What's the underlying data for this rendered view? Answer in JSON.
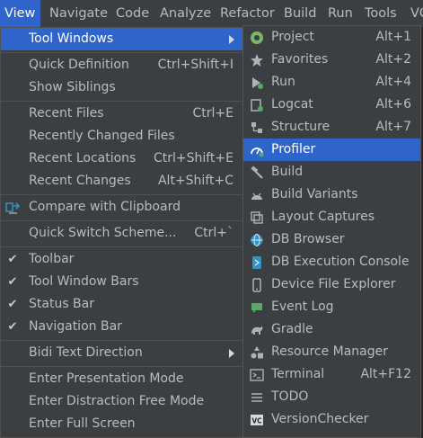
{
  "menubar": {
    "items": [
      "View",
      "Navigate",
      "Code",
      "Analyze",
      "Refactor",
      "Build",
      "Run",
      "Tools",
      "VC"
    ]
  },
  "view_menu": {
    "items": [
      {
        "label": "Tool Windows",
        "shortcut": ""
      },
      {
        "label": "Quick Definition",
        "shortcut": "Ctrl+Shift+I"
      },
      {
        "label": "Show Siblings",
        "shortcut": ""
      },
      {
        "label": "Recent Files",
        "shortcut": "Ctrl+E"
      },
      {
        "label": "Recently Changed Files",
        "shortcut": ""
      },
      {
        "label": "Recent Locations",
        "shortcut": "Ctrl+Shift+E"
      },
      {
        "label": "Recent Changes",
        "shortcut": "Alt+Shift+C"
      },
      {
        "label": "Compare with Clipboard",
        "shortcut": ""
      },
      {
        "label": "Quick Switch Scheme...",
        "shortcut": "Ctrl+`"
      },
      {
        "label": "Toolbar",
        "shortcut": "",
        "checked": true
      },
      {
        "label": "Tool Window Bars",
        "shortcut": "",
        "checked": true
      },
      {
        "label": "Status Bar",
        "shortcut": "",
        "checked": true
      },
      {
        "label": "Navigation Bar",
        "shortcut": "",
        "checked": true
      },
      {
        "label": "Bidi Text Direction",
        "shortcut": ""
      },
      {
        "label": "Enter Presentation Mode",
        "shortcut": ""
      },
      {
        "label": "Enter Distraction Free Mode",
        "shortcut": ""
      },
      {
        "label": "Enter Full Screen",
        "shortcut": ""
      }
    ]
  },
  "tool_windows_menu": {
    "items": [
      {
        "label": "Project",
        "shortcut": "Alt+1",
        "icon": "android-project-icon"
      },
      {
        "label": "Favorites",
        "shortcut": "Alt+2",
        "icon": "star-icon"
      },
      {
        "label": "Run",
        "shortcut": "Alt+4",
        "icon": "run-icon"
      },
      {
        "label": "Logcat",
        "shortcut": "Alt+6",
        "icon": "logcat-icon"
      },
      {
        "label": "Structure",
        "shortcut": "Alt+7",
        "icon": "structure-icon"
      },
      {
        "label": "Profiler",
        "shortcut": "",
        "icon": "profiler-icon"
      },
      {
        "label": "Build",
        "shortcut": "",
        "icon": "hammer-icon"
      },
      {
        "label": "Build Variants",
        "shortcut": "",
        "icon": "build-variants-icon"
      },
      {
        "label": "Layout Captures",
        "shortcut": "",
        "icon": "layout-captures-icon"
      },
      {
        "label": "DB Browser",
        "shortcut": "",
        "icon": "db-browser-icon"
      },
      {
        "label": "DB Execution Console",
        "shortcut": "",
        "icon": "db-console-icon"
      },
      {
        "label": "Device File Explorer",
        "shortcut": "",
        "icon": "device-icon"
      },
      {
        "label": "Event Log",
        "shortcut": "",
        "icon": "event-log-icon"
      },
      {
        "label": "Gradle",
        "shortcut": "",
        "icon": "gradle-icon"
      },
      {
        "label": "Resource Manager",
        "shortcut": "",
        "icon": "resource-manager-icon"
      },
      {
        "label": "Terminal",
        "shortcut": "Alt+F12",
        "icon": "terminal-icon"
      },
      {
        "label": "TODO",
        "shortcut": "",
        "icon": "todo-icon"
      },
      {
        "label": "VersionChecker",
        "shortcut": "",
        "icon": "vc-icon"
      }
    ]
  },
  "colors": {
    "menu_bg": "#3c3f41",
    "selection": "#2f65ca",
    "text": "#bbbbbb",
    "separator": "#515151"
  }
}
